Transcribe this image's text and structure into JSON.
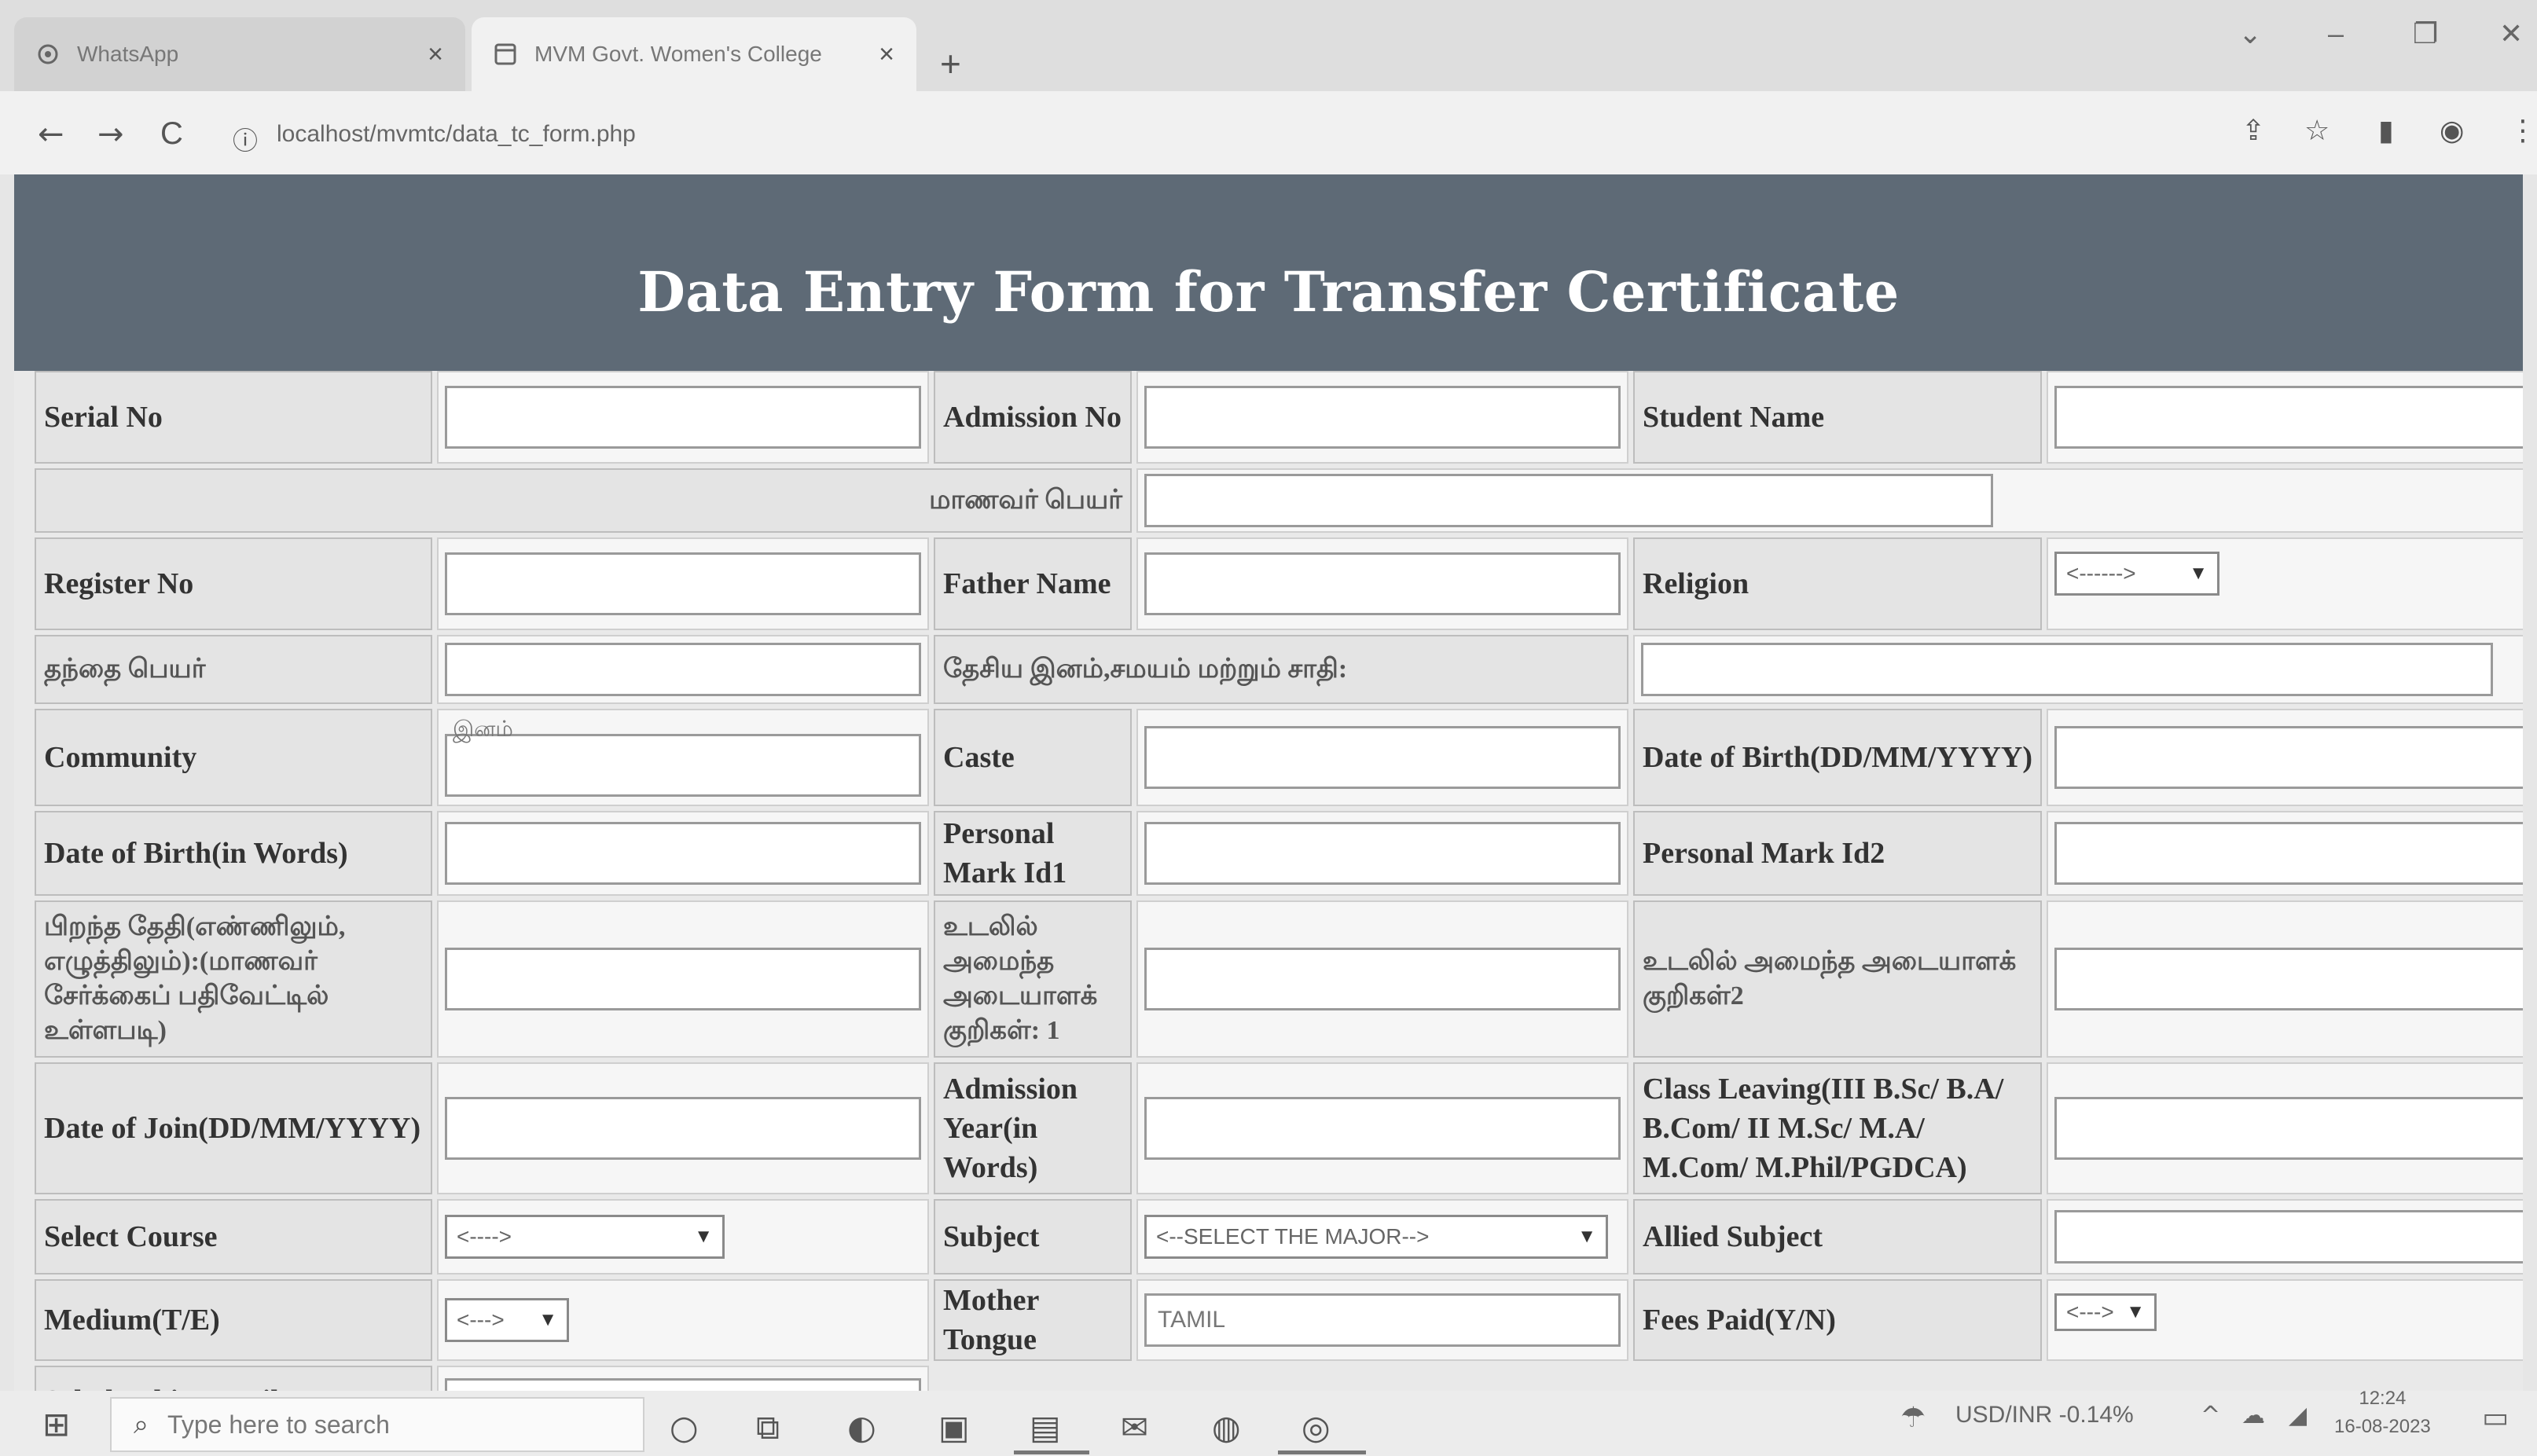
{
  "browser": {
    "tabs": [
      {
        "label": "WhatsApp",
        "close": "×"
      },
      {
        "label": "MVM Govt. Women's College",
        "close": "×"
      }
    ],
    "new_tab": "+",
    "window_controls": {
      "chevron": "⌄",
      "minimize": "–",
      "restore": "❐",
      "close": "✕"
    },
    "nav": {
      "back": "←",
      "forward": "→",
      "reload": "C"
    },
    "url": "localhost/mvmtc/data_tc_form.php"
  },
  "page": {
    "title": "Data Entry Form for Transfer Certificate"
  },
  "form": {
    "serial_no": "Serial No",
    "admission_no": "Admission No",
    "student_name": "Student Name",
    "student_name_tamil": "மாணவர் பெயர்",
    "register_no": "Register No",
    "father_name": "Father Name",
    "religion": "Religion",
    "religion_select": "<------>",
    "father_name_tamil": "தந்தை பெயர்",
    "nationality_tamil": "தேசிய இனம்,சமயம் மற்றும் சாதி:",
    "community": "Community",
    "community_placeholder": "இனம்",
    "caste": "Caste",
    "dob": "Date of Birth(DD/MM/YYYY)",
    "dob_words": "Date of Birth(in Words)",
    "personal_mark_1": "Personal Mark Id1",
    "personal_mark_2": "Personal Mark Id2",
    "dob_tamil": "பிறந்த தேதி(எண்ணிலும், எழுத்திலும்):(மாணவர் சேர்க்கைப் பதிவேட்டில் உள்ளபடி)",
    "mark_1_tamil": "உடலில் அமைந்த அடையாளக் குறிகள்: 1",
    "mark_2_tamil": "உடலில் அமைந்த அடையாளக் குறிகள்2",
    "doj": "Date of Join(DD/MM/YYYY)",
    "admission_year": "Admission Year(in Words)",
    "class_leaving": "Class Leaving(III B.Sc/ B.A/ B.Com/ II M.Sc/ M.A/ M.Com/ M.Phil/PGDCA)",
    "select_course": "Select Course",
    "course_select": "<---->",
    "subject": "Subject",
    "subject_select": "<--SELECT THE MAJOR-->",
    "allied_subject": "Allied Subject",
    "medium": "Medium(T/E)",
    "medium_select": "<--->",
    "mother_tongue": "Mother Tongue",
    "mother_tongue_value": "TAMIL",
    "fees_paid": "Fees Paid(Y/N)",
    "fees_select": "<--->",
    "scholarship_partial": "Scholarship Detail"
  },
  "taskbar": {
    "search_placeholder": "Type here to search",
    "ticker": "USD/INR  -0.14%",
    "time": "12:24",
    "date": "16-08-2023"
  }
}
